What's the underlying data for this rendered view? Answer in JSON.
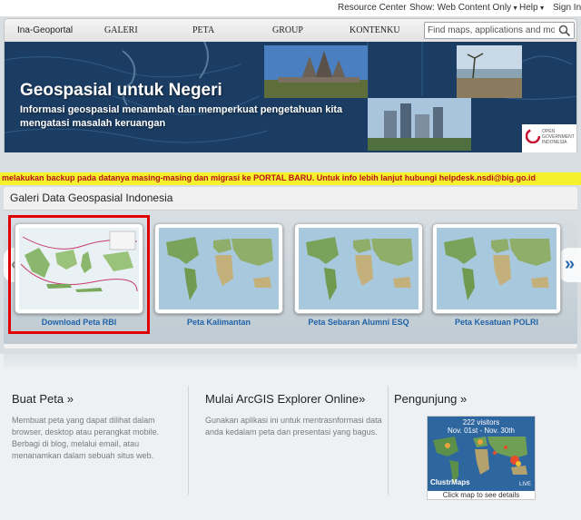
{
  "utility": {
    "resource_center": "Resource Center",
    "show_label": "Show: Web Content Only",
    "help": "Help",
    "sign_in": "Sign In"
  },
  "nav": {
    "brand": "Ina-Geoportal",
    "items": [
      "GALERI",
      "PETA",
      "GROUP",
      "KONTENKU"
    ],
    "search_placeholder": "Find maps, applications and more..."
  },
  "banner": {
    "headline": "Geospasial untuk Negeri",
    "subtitle": "Informasi geospasial menambah dan memperkuat pengetahuan kita mengatasi masalah keruangan",
    "badge_line1": "OPEN",
    "badge_line2": "GOVERNMENT",
    "badge_line3": "INDONESIA"
  },
  "ticker": {
    "text": "melakukan backup pada datanya masing-masing dan migrasi ke PORTAL BARU. Untuk info lebih lanjut hubungi helpdesk.nsdi@big.go.id"
  },
  "gallery": {
    "title": "Galeri Data Geospasial Indonesia",
    "items": [
      {
        "caption": "Download Peta RBI"
      },
      {
        "caption": "Peta Kalimantan"
      },
      {
        "caption": "Peta Sebaran Alumni ESQ"
      },
      {
        "caption": "Peta Kesatuan POLRI"
      }
    ],
    "prev_symbol": "‹",
    "next_symbol": "»"
  },
  "panels": {
    "buat_peta": {
      "title": "Buat Peta »",
      "text": "Membuat peta yang dapat dilihat dalam browser, desktop atau perangkat mobile. Berbagi di blog, melalui email, atau menanamkan dalam sebuah situs web."
    },
    "explorer": {
      "title": "Mulai ArcGIS Explorer Online»",
      "text": "Gunakan aplikasi ini untuk mentrasnformasi data anda kedalam peta dan presentasi yang bagus."
    },
    "pengunjung": {
      "title": "Pengunjung »",
      "visitors": "222 visitors",
      "range": "Nov. 01st - Nov. 30th",
      "brand": "ClustrMaps",
      "live": "LIVE",
      "caption": "Click map to see details"
    }
  },
  "colors": {
    "banner_bg": "#1b3d63",
    "ticker_bg": "#f5f12c",
    "ticker_text": "#b7131a",
    "link": "#1f62a8",
    "highlight": "#e00000"
  }
}
